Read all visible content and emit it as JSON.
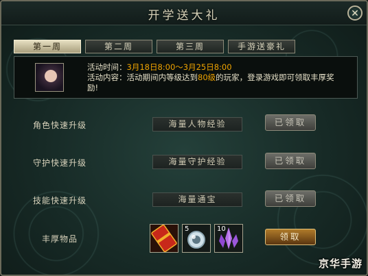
{
  "window": {
    "title": "开学送大礼"
  },
  "tabs": [
    {
      "label": "第一周",
      "active": true
    },
    {
      "label": "第二周",
      "active": false
    },
    {
      "label": "第三周",
      "active": false
    },
    {
      "label": "手游送豪礼",
      "active": false
    }
  ],
  "info": {
    "time_label": "活动时间：",
    "time_value": "3月18日8:00～3月25日8:00",
    "content_label": "活动内容：",
    "content_pre": "活动期间内等级达到",
    "content_level": "80级",
    "content_post": "的玩家，登录游戏即可领取丰厚奖",
    "content_wrap": "励!"
  },
  "rewards": [
    {
      "label": "角色快速升级",
      "item": "海量人物经验",
      "button": "已领取",
      "claimed": true
    },
    {
      "label": "守护快速升级",
      "item": "海量守护经验",
      "button": "已领取",
      "claimed": true
    },
    {
      "label": "技能快速升级",
      "item": "海量通宝",
      "button": "已领取",
      "claimed": true
    }
  ],
  "bonus": {
    "label": "丰厚物品",
    "items": [
      {
        "icon": "red-envelope-icon",
        "count": ""
      },
      {
        "icon": "crystal-orb-icon",
        "count": "5"
      },
      {
        "icon": "purple-crystal-icon",
        "count": "10"
      }
    ],
    "button": "领取"
  },
  "watermark": "京华手游",
  "colors": {
    "highlight": "#f0a400",
    "claim_button": "#b07b2a"
  }
}
